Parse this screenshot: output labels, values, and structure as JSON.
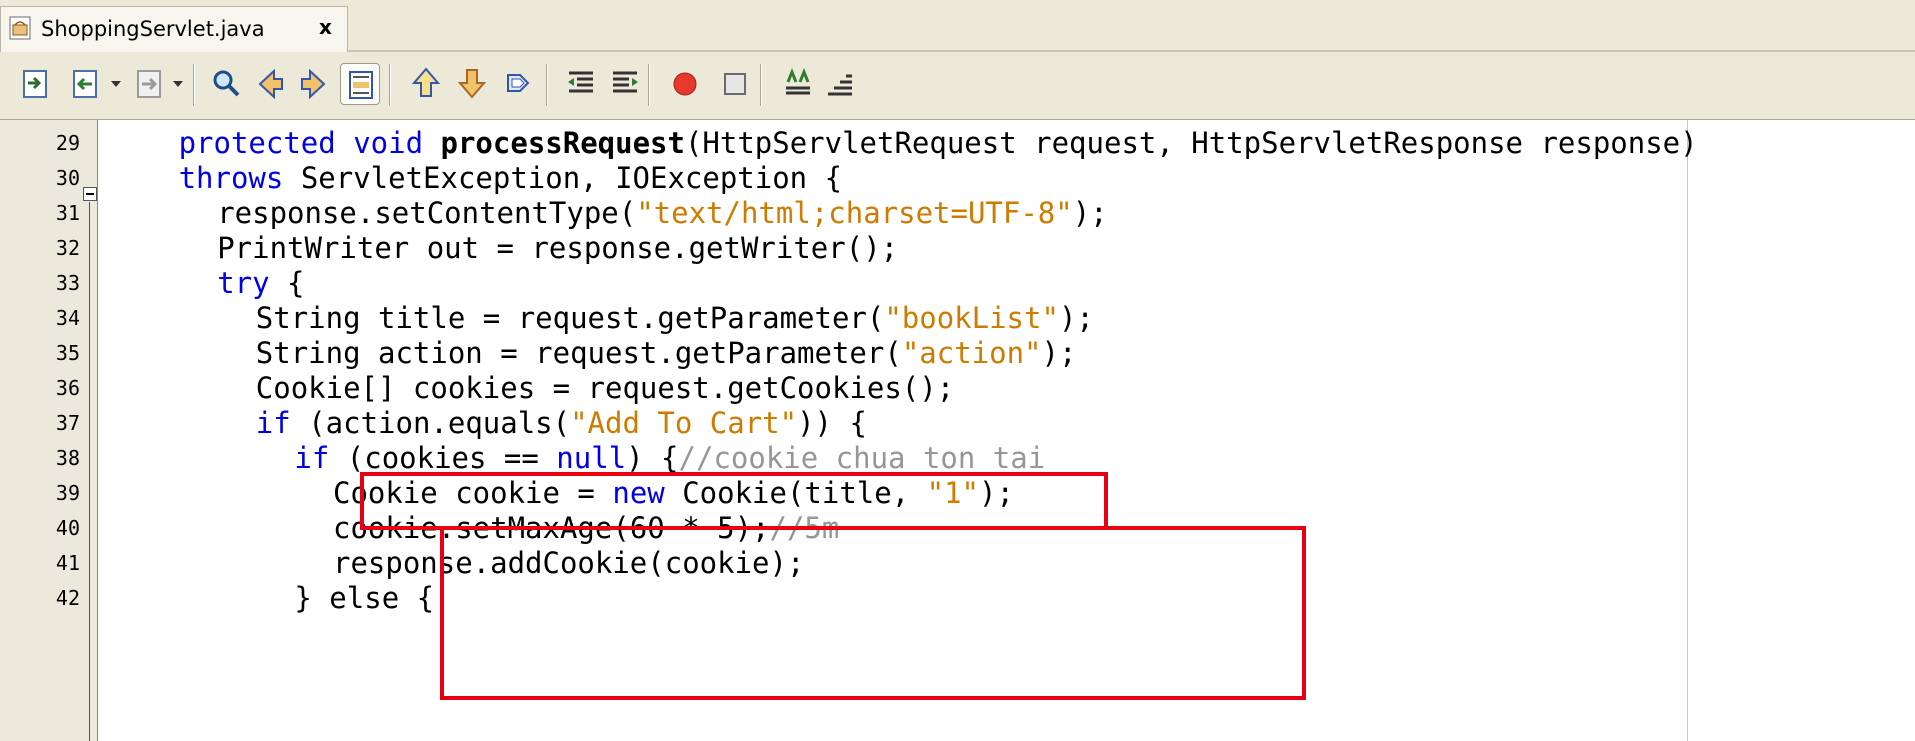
{
  "tab": {
    "title": "ShoppingServlet.java",
    "close_label": "x"
  },
  "toolbar": {
    "buttons": [
      "last-edit-icon",
      "back-icon",
      "forward-icon",
      "find-selection-icon",
      "find-previous-icon",
      "find-next-icon",
      "toggle-highlight-icon",
      "previous-bookmark-icon",
      "next-bookmark-icon",
      "toggle-bookmark-icon",
      "shift-left-icon",
      "shift-right-icon",
      "start-macro-icon",
      "stop-macro-icon",
      "comment-icon",
      "uncomment-icon"
    ]
  },
  "editor": {
    "lines": [
      {
        "num": "29",
        "indent": 2,
        "tokens": [
          [
            "kw",
            "protected "
          ],
          [
            "kw",
            "void "
          ],
          [
            "b",
            "processRequest"
          ],
          [
            "",
            "(HttpServletRequest request, HttpServletResponse response)"
          ]
        ]
      },
      {
        "num": "30",
        "indent": 2,
        "tokens": [
          [
            "kw",
            "throws "
          ],
          [
            "",
            "ServletException, IOException {"
          ]
        ]
      },
      {
        "num": "31",
        "indent": 3,
        "tokens": [
          [
            "",
            "response.setContentType("
          ],
          [
            "str",
            "\"text/html;charset=UTF-8\""
          ],
          [
            "",
            ");"
          ]
        ]
      },
      {
        "num": "32",
        "indent": 3,
        "tokens": [
          [
            "",
            "PrintWriter out = response.getWriter();"
          ]
        ]
      },
      {
        "num": "33",
        "indent": 3,
        "tokens": [
          [
            "kw",
            "try "
          ],
          [
            "",
            "{"
          ]
        ]
      },
      {
        "num": "34",
        "indent": 4,
        "tokens": [
          [
            "",
            "String title = request.getParameter("
          ],
          [
            "str",
            "\"bookList\""
          ],
          [
            "",
            ");"
          ]
        ]
      },
      {
        "num": "35",
        "indent": 4,
        "tokens": [
          [
            "",
            "String action = request.getParameter("
          ],
          [
            "str",
            "\"action\""
          ],
          [
            "",
            ");"
          ]
        ]
      },
      {
        "num": "36",
        "indent": 4,
        "tokens": [
          [
            "",
            "Cookie[] cookies = request.getCookies();"
          ]
        ]
      },
      {
        "num": "37",
        "indent": 4,
        "tokens": [
          [
            "kw",
            "if "
          ],
          [
            "",
            "(action.equals("
          ],
          [
            "str",
            "\"Add To Cart\""
          ],
          [
            "",
            ")) {"
          ]
        ]
      },
      {
        "num": "38",
        "indent": 5,
        "tokens": [
          [
            "kw",
            "if "
          ],
          [
            "",
            "(cookies == "
          ],
          [
            "kw",
            "null"
          ],
          [
            "",
            ") {"
          ],
          [
            "cm",
            "//cookie chua ton tai"
          ]
        ]
      },
      {
        "num": "39",
        "indent": 6,
        "tokens": [
          [
            "",
            "Cookie cookie = "
          ],
          [
            "kw",
            "new "
          ],
          [
            "",
            "Cookie(title, "
          ],
          [
            "str",
            "\"1\""
          ],
          [
            "",
            ");"
          ]
        ]
      },
      {
        "num": "40",
        "indent": 6,
        "tokens": [
          [
            "",
            "cookie.setMaxAge(60 * 5);"
          ],
          [
            "cm",
            "//5m"
          ]
        ]
      },
      {
        "num": "41",
        "indent": 6,
        "tokens": [
          [
            "",
            "response.addCookie(cookie);"
          ]
        ]
      },
      {
        "num": "42",
        "indent": 5,
        "tokens": [
          [
            "",
            "} else {"
          ]
        ]
      }
    ]
  },
  "highlight_color": "#e60012"
}
